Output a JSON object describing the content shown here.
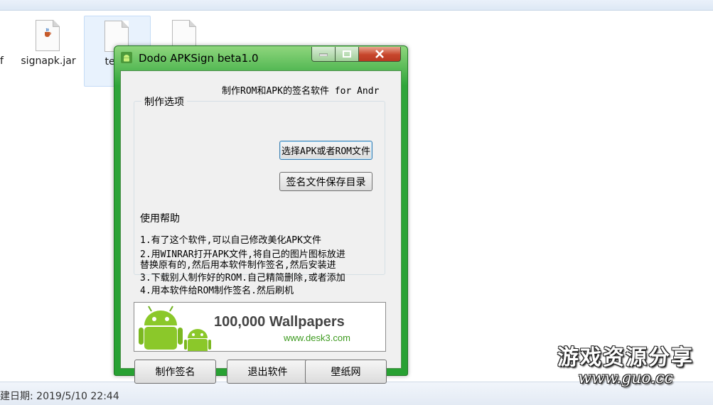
{
  "explorer": {
    "clipped_label": "f",
    "files": [
      {
        "name": "signapk.jar",
        "icon": "java-jar-icon"
      },
      {
        "name": "testk",
        "icon": "document-icon"
      },
      {
        "name": "",
        "icon": "document-icon"
      }
    ],
    "status_text": "建日期: 2019/5/10 22:44"
  },
  "window": {
    "title": "Dodo APKSign beta1.0",
    "icon": "android-icon",
    "accent_color": "#2fa53a",
    "tagline": "制作ROM和APK的签名软件 for Andr",
    "group_legend": "制作选项",
    "buttons": {
      "select_file": "选择APK或者ROM文件",
      "save_dir": "签名文件保存目录",
      "make_sign": "制作签名",
      "exit": "退出软件",
      "wallpaper": "壁纸网"
    },
    "help": {
      "title": "使用帮助",
      "lines": [
        "1.有了这个软件,可以自己修改美化APK文件",
        "2.用WINRAR打开APK文件,将自己的图片图标放进",
        "替换原有的,然后用本软件制作签名,然后安装进",
        "3.下载别人制作好的ROM.自己精简删除,或者添加",
        "4.用本软件给ROM制作签名.然后刷机"
      ]
    },
    "banner": {
      "headline": "100,000 Wallpapers",
      "url": "www.desk3.com"
    }
  },
  "watermark": {
    "line1": "游戏资源分享",
    "line2": "www.guo.cc"
  }
}
